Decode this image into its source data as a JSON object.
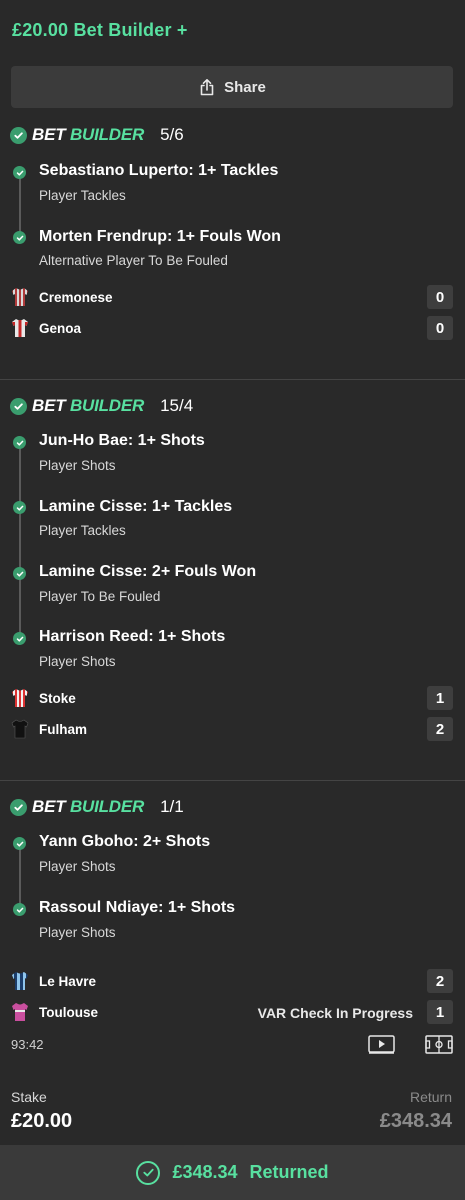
{
  "header": {
    "title": "£20.00 Bet Builder +"
  },
  "share": {
    "label": "Share",
    "icon": "share-icon"
  },
  "brand": {
    "bet": "BET",
    "builder": "BUILDER"
  },
  "colors": {
    "accent": "#58e0a0",
    "check": "#3a9d6e",
    "background": "#292929"
  },
  "builders": [
    {
      "odds": "5/6",
      "legs": [
        {
          "title": "Sebastiano Luperto: 1+ Tackles",
          "market": "Player Tackles"
        },
        {
          "title": "Morten Frendrup: 1+ Fouls Won",
          "market": "Alternative Player To Be Fouled"
        }
      ],
      "teams": [
        {
          "name": "Cremonese",
          "score": "0",
          "kit": "striped-red-grey-shirt-icon"
        },
        {
          "name": "Genoa",
          "score": "0",
          "kit": "red-white-shirt-icon"
        }
      ]
    },
    {
      "odds": "15/4",
      "legs": [
        {
          "title": "Jun-Ho Bae: 1+ Shots",
          "market": "Player Shots"
        },
        {
          "title": "Lamine Cisse: 1+ Tackles",
          "market": "Player Tackles"
        },
        {
          "title": "Lamine Cisse: 2+ Fouls Won",
          "market": "Player To Be Fouled"
        },
        {
          "title": "Harrison Reed: 1+ Shots",
          "market": "Player Shots"
        }
      ],
      "teams": [
        {
          "name": "Stoke",
          "score": "1",
          "kit": "red-white-striped-shirt-icon"
        },
        {
          "name": "Fulham",
          "score": "2",
          "kit": "black-shirt-icon"
        }
      ]
    },
    {
      "odds": "1/1",
      "legs": [
        {
          "title": "Yann Gboho: 2+ Shots",
          "market": "Player Shots"
        },
        {
          "title": "Rassoul Ndiaye: 1+ Shots",
          "market": "Player Shots"
        }
      ],
      "teams": [
        {
          "name": "Le Havre",
          "score": "2",
          "kit": "sky-blue-striped-shirt-icon",
          "status": ""
        },
        {
          "name": "Toulouse",
          "score": "1",
          "kit": "purple-shirt-icon",
          "status": "VAR Check In Progress"
        }
      ],
      "clock": "93:42"
    }
  ],
  "summary": {
    "stake_label": "Stake",
    "stake_value": "£20.00",
    "return_label": "Return",
    "return_value": "£348.34",
    "returned_amount": "£348.34",
    "returned_label": "Returned"
  }
}
